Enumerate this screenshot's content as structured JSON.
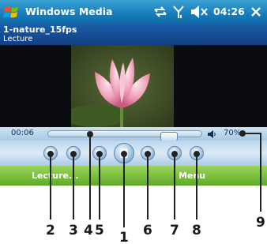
{
  "status_bar": {
    "app_title": "Windows Media",
    "time": "04:26",
    "icons": [
      "windows-start-icon",
      "connectivity-icon",
      "signal-icon",
      "volume-icon",
      "close-icon"
    ]
  },
  "track": {
    "title": "1-nature_15fps",
    "artist": "Lecture"
  },
  "playback": {
    "elapsed": "00:06",
    "volume": "70%"
  },
  "controls": {
    "buttons": [
      "fullscreen",
      "flip",
      "previous",
      "play-pause",
      "next",
      "volume-down",
      "volume-up"
    ]
  },
  "softkeys": {
    "left": "Lecture...",
    "right": "Menu"
  },
  "callouts": [
    "1",
    "2",
    "3",
    "4",
    "5",
    "6",
    "7",
    "8",
    "9"
  ],
  "colors": {
    "title_bar": "#1a7fbd",
    "info_bar": "#1b5ea8",
    "softkey_bar": "#7bbf3b",
    "video_bg": "#0b0b12"
  }
}
